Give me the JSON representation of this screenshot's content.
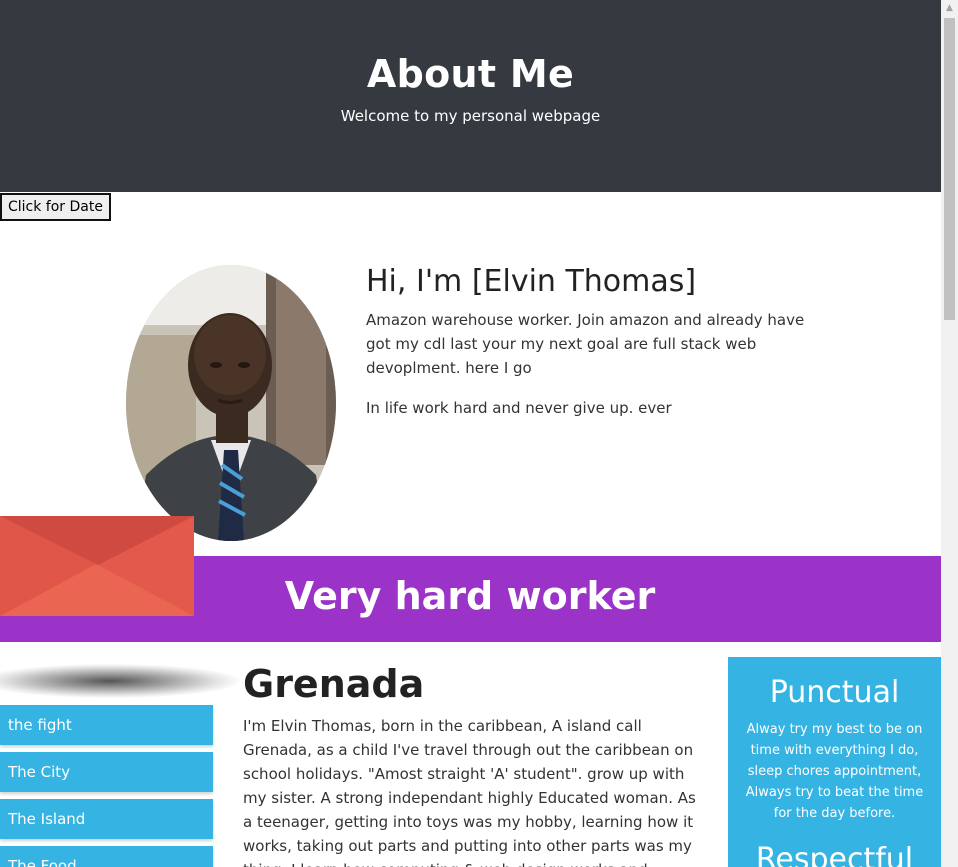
{
  "header": {
    "title": "About Me",
    "subtitle": "Welcome to my personal webpage"
  },
  "date_button": {
    "label": "Click for Date"
  },
  "intro": {
    "heading": "Hi, I'm [Elvin Thomas]",
    "paragraph1": "Amazon warehouse worker. Join amazon and already have got my cdl last your my next goal are full stack web devoplment. here I go",
    "paragraph2": "In life work hard and never give up. ever"
  },
  "banner": {
    "text": "Very hard worker"
  },
  "side_nav": {
    "items": [
      {
        "label": "the fight"
      },
      {
        "label": "The City"
      },
      {
        "label": "The Island"
      },
      {
        "label": "The Food"
      }
    ]
  },
  "main": {
    "heading": "Grenada",
    "paragraph": "I'm Elvin Thomas, born in the caribbean, A island call Grenada, as a child I've travel through out the caribbean on school holidays. \"Amost straight 'A' student\". grow up with my sister. A strong independant highly Educated woman. As a teenager, getting into toys was my hobby, learning how it works, taking out parts and putting into other parts was my thing. I learn how computing & web design works and always try to learn and"
  },
  "aside": {
    "heading1": "Punctual",
    "text1": "Alway try my best to be on time with everything I do, sleep chores appointment, Always try to beat the time for the day before.",
    "heading2": "Respectful"
  },
  "colors": {
    "header_bg": "#343a40",
    "banner_bg": "#9b33c9",
    "accent_blue": "#35b4e3",
    "envelope_red": "#e35a4d"
  }
}
